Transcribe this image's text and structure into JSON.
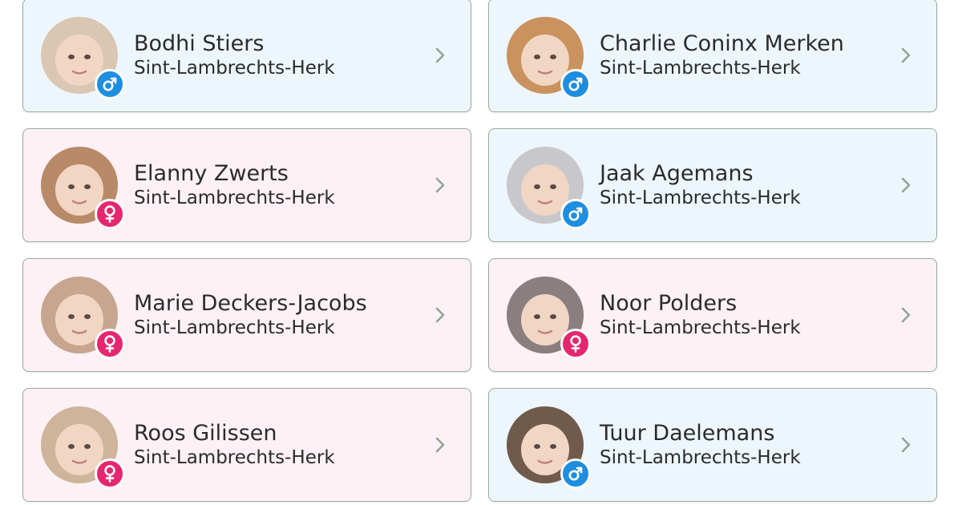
{
  "babies": [
    {
      "name": "Bodhi Stiers",
      "place": "Sint-Lambrechts-Herk",
      "gender": "boy",
      "gender_icon": "male-icon",
      "accent": "#1d8ee0",
      "photo_tone": "#d9c7b4"
    },
    {
      "name": "Charlie Coninx Merken",
      "place": "Sint-Lambrechts-Herk",
      "gender": "boy",
      "gender_icon": "male-icon",
      "accent": "#1d8ee0",
      "photo_tone": "#c9925f"
    },
    {
      "name": "Elanny Zwerts",
      "place": "Sint-Lambrechts-Herk",
      "gender": "girl",
      "gender_icon": "female-icon",
      "accent": "#e5276f",
      "photo_tone": "#b98a68"
    },
    {
      "name": "Jaak Agemans",
      "place": "Sint-Lambrechts-Herk",
      "gender": "boy",
      "gender_icon": "male-icon",
      "accent": "#1d8ee0",
      "photo_tone": "#c8c8cc"
    },
    {
      "name": "Marie Deckers-Jacobs",
      "place": "Sint-Lambrechts-Herk",
      "gender": "girl",
      "gender_icon": "female-icon",
      "accent": "#e5276f",
      "photo_tone": "#c7a58f"
    },
    {
      "name": "Noor Polders",
      "place": "Sint-Lambrechts-Herk",
      "gender": "girl",
      "gender_icon": "female-icon",
      "accent": "#e5276f",
      "photo_tone": "#8a7f80"
    },
    {
      "name": "Roos Gilissen",
      "place": "Sint-Lambrechts-Herk",
      "gender": "girl",
      "gender_icon": "female-icon",
      "accent": "#e5276f",
      "photo_tone": "#cdb49a"
    },
    {
      "name": "Tuur Daelemans",
      "place": "Sint-Lambrechts-Herk",
      "gender": "boy",
      "gender_icon": "male-icon",
      "accent": "#1d8ee0",
      "photo_tone": "#6f5a4c"
    }
  ],
  "colors": {
    "boy_card_bg": "#eef6fd",
    "girl_card_bg": "#fdf1f5",
    "card_border": "#98ab9b",
    "chevron": "#8fa595",
    "text": "#2b2b2b"
  },
  "chevron_icon": "chevron-right-icon"
}
